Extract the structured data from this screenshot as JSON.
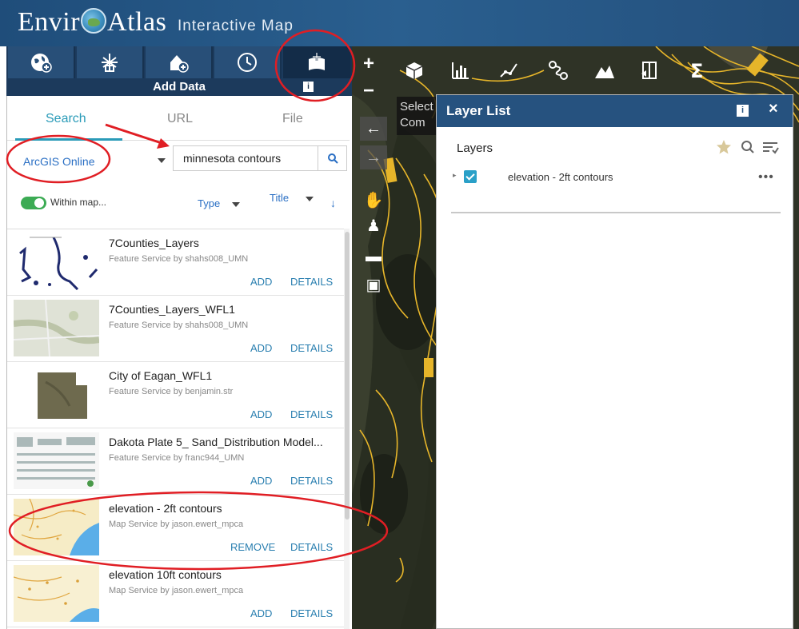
{
  "header": {
    "logo_prefix": "Envir",
    "logo_suffix": "Atlas",
    "subtitle": "Interactive Map"
  },
  "toolbar": {
    "tools": [
      "globe-add-icon",
      "chart-tree-icon",
      "house-add-icon",
      "clock-icon",
      "add-data-icon"
    ],
    "active_label": "Add Data",
    "active_info": "i"
  },
  "map": {
    "zoom_in": "+",
    "zoom_out": "−",
    "select_tip": "Select Com",
    "tools": [
      "cube-icon",
      "bar-chart-icon",
      "draw-line-icon",
      "route-icon",
      "elevation-profile-icon",
      "layer-swipe-icon",
      "sigma-icon"
    ],
    "nav": [
      "back-arrow-icon",
      "forward-arrow-icon",
      "hand-icon",
      "person-pin-icon",
      "minus-icon",
      "usa-map-icon"
    ]
  },
  "panel": {
    "tabs": [
      "Search",
      "URL",
      "File"
    ],
    "active_tab": "Search",
    "source": "ArcGIS Online",
    "search_value": "minnesota contours",
    "within_map": "Within map...",
    "type_label": "Type",
    "title_label": "Title",
    "results": [
      {
        "title": "7Counties_Layers",
        "subtitle": "Feature Service by shahs008_UMN",
        "action": "ADD",
        "details": "DETAILS"
      },
      {
        "title": "7Counties_Layers_WFL1",
        "subtitle": "Feature Service by shahs008_UMN",
        "action": "ADD",
        "details": "DETAILS"
      },
      {
        "title": "City of Eagan_WFL1",
        "subtitle": "Feature Service by benjamin.str",
        "action": "ADD",
        "details": "DETAILS"
      },
      {
        "title": "Dakota Plate 5_ Sand_Distribution Model...",
        "subtitle": "Feature Service by franc944_UMN",
        "action": "ADD",
        "details": "DETAILS"
      },
      {
        "title": "elevation - 2ft contours",
        "subtitle": "Map Service by jason.ewert_mpca",
        "action": "REMOVE",
        "details": "DETAILS"
      },
      {
        "title": "elevation 10ft contours",
        "subtitle": "Map Service by jason.ewert_mpca",
        "action": "ADD",
        "details": "DETAILS"
      }
    ]
  },
  "layer_list": {
    "title": "Layer List",
    "info": "i",
    "close": "×",
    "layers_heading": "Layers",
    "layers": [
      {
        "name": "elevation - 2ft contours",
        "checked": true
      }
    ],
    "menu": "•••"
  },
  "colors": {
    "header": "#1f4d7a",
    "accent": "#2a9bb8",
    "link": "#2a7fb0",
    "toggle_on": "#3cab54",
    "annotation": "#e01e24"
  }
}
